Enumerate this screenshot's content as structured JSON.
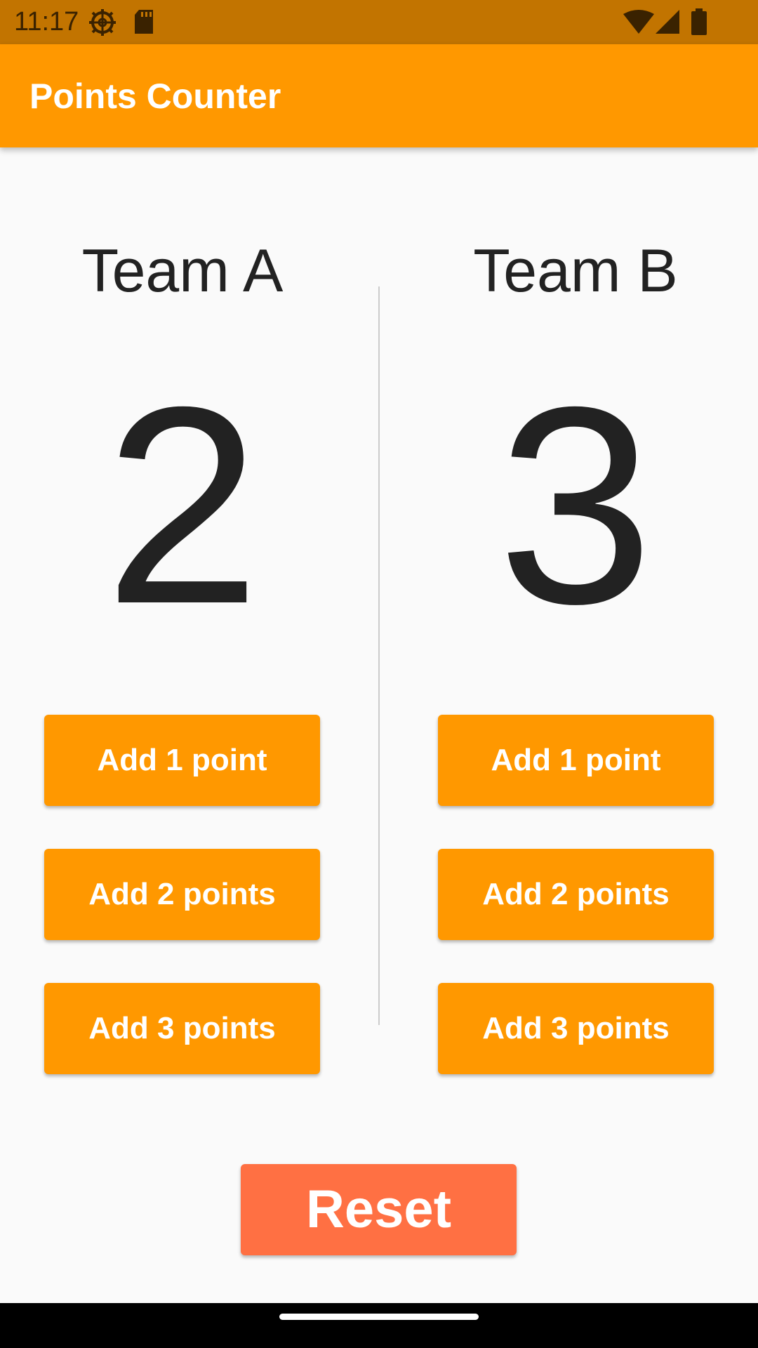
{
  "status_bar": {
    "time": "11:17",
    "icons": [
      "gear-icon",
      "sd-card-icon",
      "wifi-icon",
      "cell-signal-icon",
      "battery-icon"
    ]
  },
  "app_bar": {
    "title": "Points Counter",
    "color": "#ff9800"
  },
  "team_a": {
    "name": "Team A",
    "score": "2",
    "buttons": [
      "Add 1 point",
      "Add 2 points",
      "Add 3 points"
    ]
  },
  "team_b": {
    "name": "Team B",
    "score": "3",
    "buttons": [
      "Add 1 point",
      "Add 2 points",
      "Add 3 points"
    ]
  },
  "reset": {
    "label": "Reset",
    "color": "#ff7043"
  }
}
